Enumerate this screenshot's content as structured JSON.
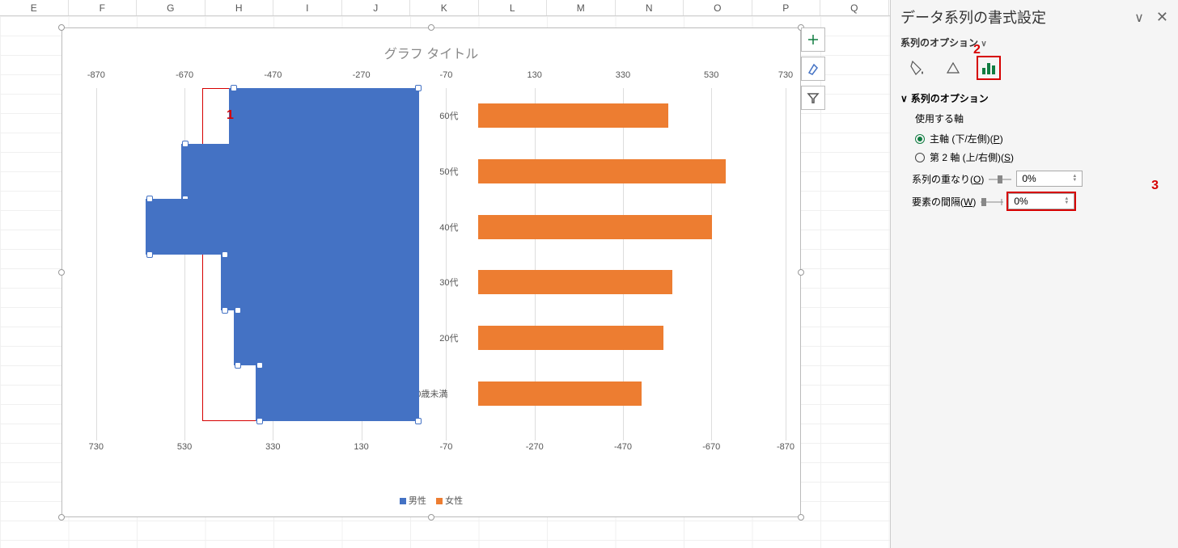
{
  "columns": [
    "E",
    "F",
    "G",
    "H",
    "I",
    "J",
    "K",
    "L",
    "M",
    "N",
    "O",
    "P",
    "Q"
  ],
  "chart": {
    "title": "グラフ タイトル",
    "legend_male": "男性",
    "legend_female": "女性",
    "top_axis": [
      "-870",
      "-670",
      "-470",
      "-270",
      "-70",
      "130",
      "330",
      "530",
      "730"
    ],
    "bottom_axis": [
      "730",
      "530",
      "330",
      "130",
      "-70",
      "-270",
      "-470",
      "-670",
      "-870"
    ],
    "categories": [
      "60代",
      "50代",
      "40代",
      "30代",
      "20代",
      "20歳未満"
    ]
  },
  "chart_data": {
    "type": "bar",
    "categories": [
      "60代",
      "50代",
      "40代",
      "30代",
      "20代",
      "20歳未満"
    ],
    "series": [
      {
        "name": "男性",
        "values": [
          -430,
          -540,
          -620,
          -450,
          -420,
          -370
        ],
        "color": "#4472c4"
      },
      {
        "name": "女性",
        "values": [
          430,
          560,
          530,
          440,
          420,
          370
        ],
        "color": "#ed7d31"
      }
    ],
    "title": "グラフ タイトル",
    "xlabel": "",
    "ylabel": "",
    "x_axis_top": {
      "min": -870,
      "max": 730,
      "step": 200
    },
    "x_axis_bottom": {
      "min": 730,
      "max": -870,
      "step": -200
    },
    "note": "Population-pyramid style: male series plotted leftward (negative on top axis), female plotted rightward (positive on top axis). Bottom axis reversed."
  },
  "sidetools": {
    "plus": "+",
    "brush": "brush",
    "filter": "filter"
  },
  "annotations": {
    "a1": "1",
    "a2": "2",
    "a3": "3"
  },
  "panel": {
    "title": "データ系列の書式設定",
    "sub": "系列のオプション",
    "section": "系列のオプション",
    "axis_label": "使用する軸",
    "primary": "主軸 (下/左側)(",
    "primary_key": "P",
    "secondary": "第 2 軸 (上/右側)(",
    "secondary_key": "S",
    "overlap": "系列の重なり(",
    "overlap_key": "O",
    "overlap_val": "0%",
    "gap": "要素の間隔(",
    "gap_key": "W",
    "gap_val": "0%"
  }
}
